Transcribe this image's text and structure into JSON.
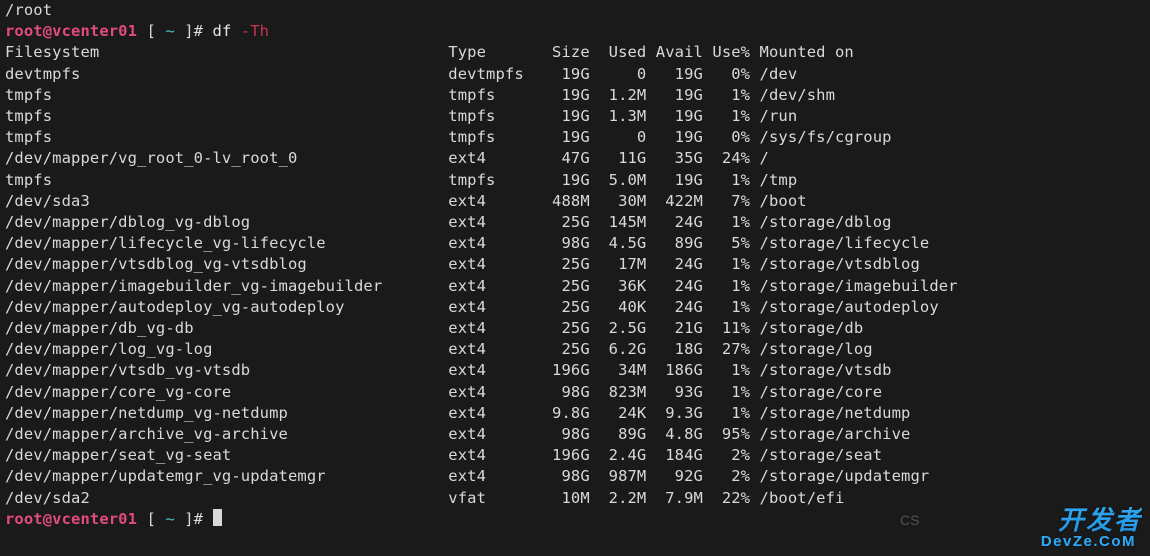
{
  "pre_line": "/root",
  "prompt": {
    "user_host": "root@vcenter01",
    "frame_open": " [ ",
    "cwd": "~",
    "frame_close": " ]# ",
    "cmd": "df",
    "opt": "-Th"
  },
  "header": {
    "fs": "Filesystem",
    "type": "Type",
    "size": "Size",
    "used": "Used",
    "avail": "Avail",
    "usep": "Use%",
    "mount": "Mounted on"
  },
  "rows": [
    {
      "fs": "devtmpfs",
      "type": "devtmpfs",
      "size": "19G",
      "used": "0",
      "avail": "19G",
      "usep": "0%",
      "mount": "/dev"
    },
    {
      "fs": "tmpfs",
      "type": "tmpfs",
      "size": "19G",
      "used": "1.2M",
      "avail": "19G",
      "usep": "1%",
      "mount": "/dev/shm"
    },
    {
      "fs": "tmpfs",
      "type": "tmpfs",
      "size": "19G",
      "used": "1.3M",
      "avail": "19G",
      "usep": "1%",
      "mount": "/run"
    },
    {
      "fs": "tmpfs",
      "type": "tmpfs",
      "size": "19G",
      "used": "0",
      "avail": "19G",
      "usep": "0%",
      "mount": "/sys/fs/cgroup"
    },
    {
      "fs": "/dev/mapper/vg_root_0-lv_root_0",
      "type": "ext4",
      "size": "47G",
      "used": "11G",
      "avail": "35G",
      "usep": "24%",
      "mount": "/"
    },
    {
      "fs": "tmpfs",
      "type": "tmpfs",
      "size": "19G",
      "used": "5.0M",
      "avail": "19G",
      "usep": "1%",
      "mount": "/tmp"
    },
    {
      "fs": "/dev/sda3",
      "type": "ext4",
      "size": "488M",
      "used": "30M",
      "avail": "422M",
      "usep": "7%",
      "mount": "/boot"
    },
    {
      "fs": "/dev/mapper/dblog_vg-dblog",
      "type": "ext4",
      "size": "25G",
      "used": "145M",
      "avail": "24G",
      "usep": "1%",
      "mount": "/storage/dblog"
    },
    {
      "fs": "/dev/mapper/lifecycle_vg-lifecycle",
      "type": "ext4",
      "size": "98G",
      "used": "4.5G",
      "avail": "89G",
      "usep": "5%",
      "mount": "/storage/lifecycle"
    },
    {
      "fs": "/dev/mapper/vtsdblog_vg-vtsdblog",
      "type": "ext4",
      "size": "25G",
      "used": "17M",
      "avail": "24G",
      "usep": "1%",
      "mount": "/storage/vtsdblog"
    },
    {
      "fs": "/dev/mapper/imagebuilder_vg-imagebuilder",
      "type": "ext4",
      "size": "25G",
      "used": "36K",
      "avail": "24G",
      "usep": "1%",
      "mount": "/storage/imagebuilder"
    },
    {
      "fs": "/dev/mapper/autodeploy_vg-autodeploy",
      "type": "ext4",
      "size": "25G",
      "used": "40K",
      "avail": "24G",
      "usep": "1%",
      "mount": "/storage/autodeploy"
    },
    {
      "fs": "/dev/mapper/db_vg-db",
      "type": "ext4",
      "size": "25G",
      "used": "2.5G",
      "avail": "21G",
      "usep": "11%",
      "mount": "/storage/db"
    },
    {
      "fs": "/dev/mapper/log_vg-log",
      "type": "ext4",
      "size": "25G",
      "used": "6.2G",
      "avail": "18G",
      "usep": "27%",
      "mount": "/storage/log"
    },
    {
      "fs": "/dev/mapper/vtsdb_vg-vtsdb",
      "type": "ext4",
      "size": "196G",
      "used": "34M",
      "avail": "186G",
      "usep": "1%",
      "mount": "/storage/vtsdb"
    },
    {
      "fs": "/dev/mapper/core_vg-core",
      "type": "ext4",
      "size": "98G",
      "used": "823M",
      "avail": "93G",
      "usep": "1%",
      "mount": "/storage/core"
    },
    {
      "fs": "/dev/mapper/netdump_vg-netdump",
      "type": "ext4",
      "size": "9.8G",
      "used": "24K",
      "avail": "9.3G",
      "usep": "1%",
      "mount": "/storage/netdump"
    },
    {
      "fs": "/dev/mapper/archive_vg-archive",
      "type": "ext4",
      "size": "98G",
      "used": "89G",
      "avail": "4.8G",
      "usep": "95%",
      "mount": "/storage/archive"
    },
    {
      "fs": "/dev/mapper/seat_vg-seat",
      "type": "ext4",
      "size": "196G",
      "used": "2.4G",
      "avail": "184G",
      "usep": "2%",
      "mount": "/storage/seat"
    },
    {
      "fs": "/dev/mapper/updatemgr_vg-updatemgr",
      "type": "ext4",
      "size": "98G",
      "used": "987M",
      "avail": "92G",
      "usep": "2%",
      "mount": "/storage/updatemgr"
    },
    {
      "fs": "/dev/sda2",
      "type": "vfat",
      "size": "10M",
      "used": "2.2M",
      "avail": "7.9M",
      "usep": "22%",
      "mount": "/boot/efi"
    }
  ],
  "columns": {
    "fs_width": 47,
    "type_width": 9,
    "size_width": 6,
    "used_width": 6,
    "avail_width": 6,
    "usep_width": 5
  },
  "watermark": {
    "main": "开发者",
    "sub": "DevZe.CoM"
  },
  "faint_watermark": "CS"
}
